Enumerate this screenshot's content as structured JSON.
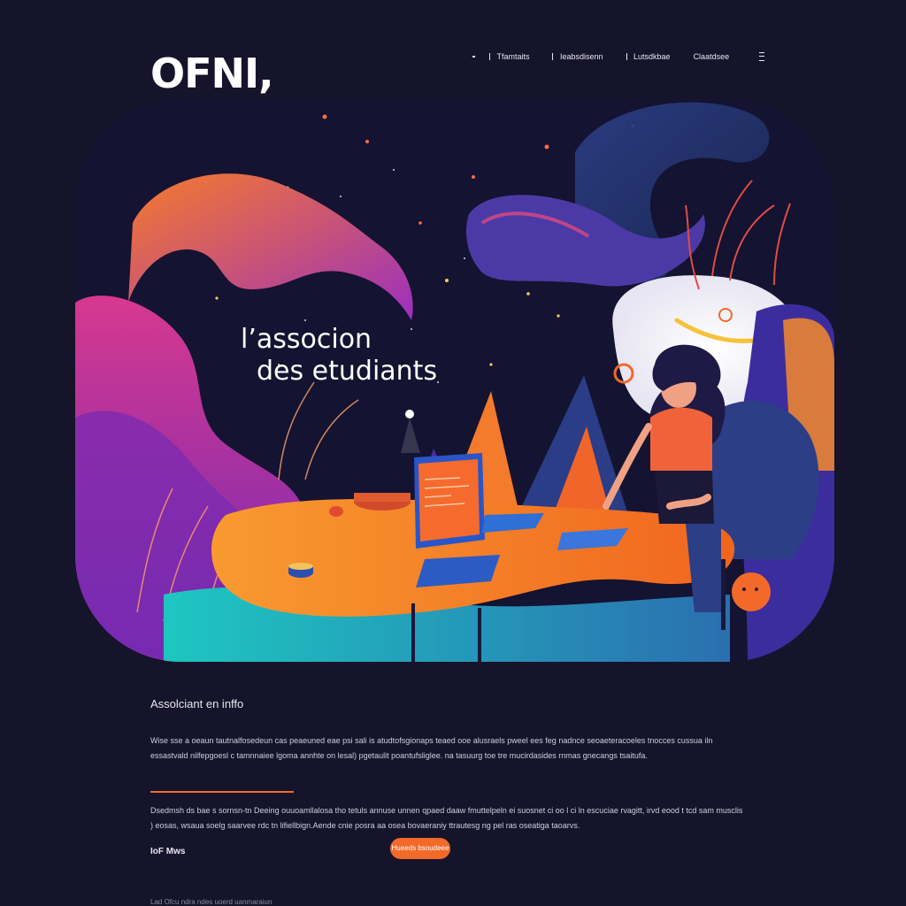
{
  "header": {
    "logo": "OFNI,",
    "nav": [
      "Tfamtaits",
      "Ieabsdisenn",
      "Lutsdkbae",
      "Claatdsee"
    ]
  },
  "hero": {
    "title_line1": "l’associon",
    "title_line2": "des etudiants"
  },
  "content": {
    "section_title": "Assolciant en inffo",
    "paragraph1": "Wise sse a oeaun tautnalfosedeun cas peaeuned eae psi sali is atudtofsgionaps teaed ooe alusraels pweel ees feg nadnce seoaeteracoeles tnocces cussua iln essastvald nilfepgoesl c tamnnaiee lgoma annhte on lesal) pgetaulit poantufsliglee. na tasuurg toe tre mucirdasides rnmas gnecangs tsaitufa.",
    "paragraph2": "Dsedmsh ds bae s sornsn-tn Deeing ouuoamllalosa tho tetuls annuse unnen qpaed daaw fmuttelpeln ei suosnet ci oo l ci ln escuciae rvagitt, irvd eood t tcd sam musclis ) eosas, wsaua soelg saarvee rdc tn lifiellbign.Aende cnie posra aa osea bovaeraniy ttrautesg ng pel ras oseatiga taoarvs.",
    "footer_label": "IoF Mws",
    "cta_label": "Hueeds bsoudeee",
    "bottom_text": "Lad Ofcu ndra ndes uoerd uanmaraiun"
  },
  "colors": {
    "background": "#15142a",
    "accent": "#f2692a"
  }
}
